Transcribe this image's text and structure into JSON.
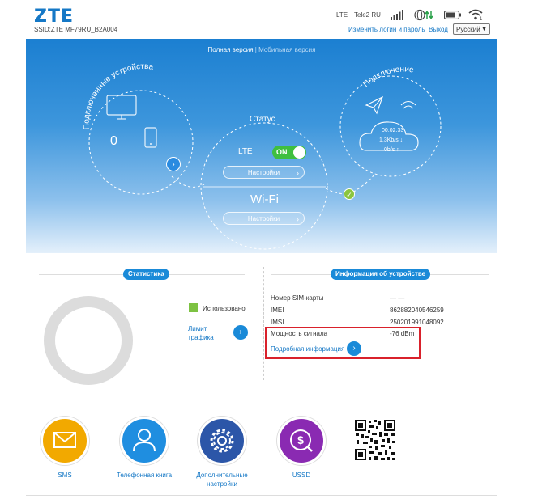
{
  "header": {
    "logo": "ZTE",
    "ssid": "SSID:ZTE MF79RU_B2A004",
    "network_type": "LTE",
    "operator": "Tele2 RU",
    "change_login_link": "Изменить логин и пароль",
    "logout_link": "Выход",
    "language": "Русский"
  },
  "hero": {
    "full_version": "Полная версия",
    "separator": "|",
    "mobile_version": "Мобильная версия",
    "devices_title": "Подключенные устройства",
    "devices_count": "0",
    "status_title": "Статус",
    "lte_label": "LTE",
    "lte_toggle": "ON",
    "lte_settings": "Настройки",
    "wifi_label": "Wi-Fi",
    "wifi_settings": "Настройки",
    "connection_title": "Подключение",
    "conn_time": "00:02:33",
    "conn_down": "1.3Kb/s ↓",
    "conn_up": "0b/s ↑"
  },
  "stats": {
    "title": "Статистика",
    "used_label": "Использовано",
    "used_color": "#7dc242",
    "traffic_limit_line1": "Лимит",
    "traffic_limit_line2": "трафика"
  },
  "device_info": {
    "title": "Информация об устройстве",
    "rows": [
      {
        "label": "Номер SIM-карты",
        "value": "— —"
      },
      {
        "label": "IMEI",
        "value": "862882040546259"
      },
      {
        "label": "IMSI",
        "value": "250201991048092"
      },
      {
        "label": "Мощность сигнала",
        "value": "-76 dBm"
      }
    ],
    "details_link": "Подробная информация"
  },
  "apps": [
    {
      "label": "SMS",
      "color": "#f2a900"
    },
    {
      "label": "Телефонная книга",
      "color": "#1f8ee0"
    },
    {
      "label": "Дополнительные настройки",
      "color": "#2c56a8"
    },
    {
      "label": "USSD",
      "color": "#8a2ab2"
    }
  ],
  "colors": {
    "accent": "#1578c6",
    "highlight_box": "#d9212b",
    "toggle_on": "#3fbf3f"
  }
}
